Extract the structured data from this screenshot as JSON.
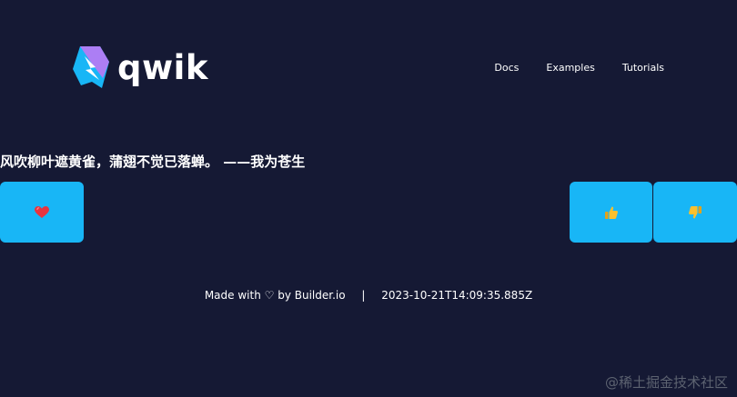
{
  "brand": {
    "name": "qwik",
    "colors": {
      "background": "#151934",
      "button": "#18b6f6",
      "logo_purple": "#ac7ef4",
      "logo_blue": "#18b6f6"
    }
  },
  "nav": {
    "items": [
      {
        "label": "Docs"
      },
      {
        "label": "Examples"
      },
      {
        "label": "Tutorials"
      }
    ]
  },
  "main": {
    "quote": "风吹柳叶遮黄雀，蒲翅不觉已落蝉。 ——我为苍生",
    "buttons": {
      "heart_icon": "heart-icon",
      "thumbs_up_icon": "thumbs-up-icon",
      "thumbs_down_icon": "thumbs-down-icon"
    }
  },
  "footer": {
    "made_with": "Made with ♡ by Builder.io",
    "separator": "|",
    "timestamp": "2023-10-21T14:09:35.885Z"
  },
  "watermark": "@稀土掘金技术社区"
}
